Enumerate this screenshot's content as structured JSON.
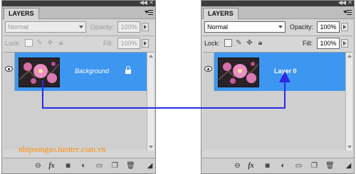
{
  "left_panel": {
    "tab_label": "LAYERS",
    "blend_mode": "Normal",
    "opacity_label": "Opacity:",
    "opacity_value": "100%",
    "lock_label": "Lock:",
    "fill_label": "Fill:",
    "fill_value": "100%",
    "layer": {
      "name": "Background",
      "locked": true,
      "visible": true
    }
  },
  "right_panel": {
    "tab_label": "LAYERS",
    "blend_mode": "Normal",
    "opacity_label": "Opacity:",
    "opacity_value": "100%",
    "lock_label": "Lock:",
    "fill_label": "Fill:",
    "fill_value": "100%",
    "layer": {
      "name": "Layer 0",
      "locked": false,
      "visible": true
    }
  },
  "bottom_icons": [
    "link-layers-icon",
    "fx-icon",
    "add-mask-icon",
    "adjustment-layer-icon",
    "new-group-icon",
    "new-layer-icon",
    "delete-layer-icon"
  ],
  "watermark": "nhipsongso.tuoitre.com.vn",
  "colors": {
    "selection": "#3d97f0",
    "arrow": "#2a2ae6",
    "watermark": "#ff8a00",
    "panel": "#d6d6d6"
  }
}
